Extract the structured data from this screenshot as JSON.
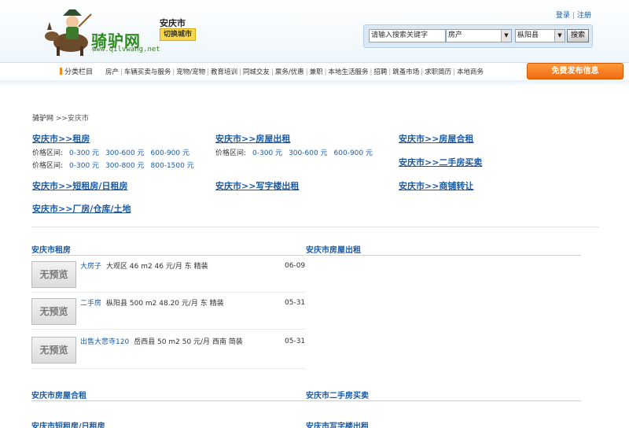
{
  "header": {
    "logo_text": "骑驴网",
    "logo_url": "www.qilvwang.net",
    "city": "安庆市",
    "switch_city": "切换城市",
    "login": "登录",
    "register": "注册",
    "search": {
      "placeholder": "请输入搜索关键字",
      "category": "房产",
      "region": "枞阳县",
      "button": "搜索"
    }
  },
  "nav": {
    "category_label": "分类栏目",
    "items": [
      "房产",
      "车辆买卖与服务",
      "宠物/宠物",
      "教育培训",
      "同城交友",
      "票务/优惠",
      "兼职",
      "本地生活服务",
      "招聘",
      "跳蚤市场",
      "求职简历",
      "本地商务"
    ],
    "post_button": "免费发布信息"
  },
  "breadcrumb": {
    "home": "骑驴网",
    "current": ">>安庆市"
  },
  "categories": {
    "zufang": {
      "title": "安庆市>>租房",
      "price_rows": [
        {
          "label": "价格区间:",
          "ranges": [
            "0-300 元",
            "300-600 元",
            "600-900 元"
          ]
        },
        {
          "label": "价格区间:",
          "ranges": [
            "0-300 元",
            "300-800 元",
            "800-1500 元"
          ]
        }
      ]
    },
    "fangwu": {
      "title": "安庆市>>房屋出租",
      "price_rows": [
        {
          "label": "价格区间:",
          "ranges": [
            "0-300 元",
            "300-600 元",
            "600-900 元"
          ]
        }
      ]
    },
    "hezu": {
      "title": "安庆市>>房屋合租"
    },
    "ershou": {
      "title": "安庆市>>二手房买卖"
    },
    "duanzu": {
      "title": "安庆市>>短租房/日租房"
    },
    "xiezilou": {
      "title": "安庆市>>写字楼出租"
    },
    "shangpu": {
      "title": "安庆市>>商铺转让"
    },
    "changfang": {
      "title": "安庆市>>厂房/仓库/土地"
    }
  },
  "sections": {
    "zufang_title": "安庆市租房",
    "fangwu_title": "安庆市房屋出租",
    "hezu_title": "安庆市房屋合租",
    "ershou_title": "安庆市二手房买卖",
    "duanzu_title": "安庆市短租房/日租房",
    "xiezilou_title": "安庆市写字楼出租"
  },
  "listings": [
    {
      "thumb": "无预览",
      "title": "大房子",
      "details": "大观区 46 m2 46 元/月 东 精装",
      "date": "06-09"
    },
    {
      "thumb": "无预览",
      "title": "二手房",
      "details": "枞阳县 500 m2 48.20 元/月 东 精装",
      "date": "05-31"
    },
    {
      "thumb": "无预览",
      "title": "出售大悲寺120",
      "details": "岳西县 50 m2 50 元/月 西南 简装",
      "date": "05-31"
    }
  ]
}
